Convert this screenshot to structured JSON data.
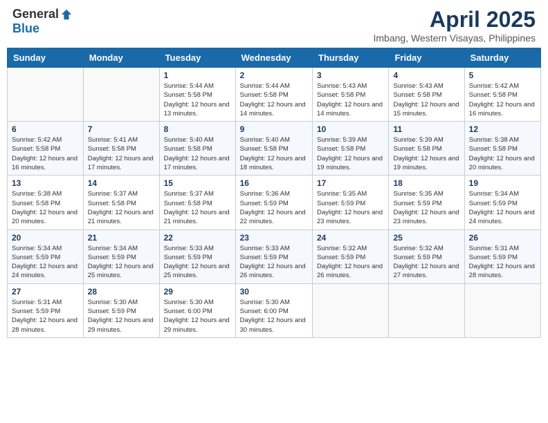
{
  "header": {
    "logo_general": "General",
    "logo_blue": "Blue",
    "month_title": "April 2025",
    "location": "Imbang, Western Visayas, Philippines"
  },
  "weekdays": [
    "Sunday",
    "Monday",
    "Tuesday",
    "Wednesday",
    "Thursday",
    "Friday",
    "Saturday"
  ],
  "weeks": [
    [
      {
        "day": "",
        "info": ""
      },
      {
        "day": "",
        "info": ""
      },
      {
        "day": "1",
        "info": "Sunrise: 5:44 AM\nSunset: 5:58 PM\nDaylight: 12 hours\nand 13 minutes."
      },
      {
        "day": "2",
        "info": "Sunrise: 5:44 AM\nSunset: 5:58 PM\nDaylight: 12 hours\nand 14 minutes."
      },
      {
        "day": "3",
        "info": "Sunrise: 5:43 AM\nSunset: 5:58 PM\nDaylight: 12 hours\nand 14 minutes."
      },
      {
        "day": "4",
        "info": "Sunrise: 5:43 AM\nSunset: 5:58 PM\nDaylight: 12 hours\nand 15 minutes."
      },
      {
        "day": "5",
        "info": "Sunrise: 5:42 AM\nSunset: 5:58 PM\nDaylight: 12 hours\nand 16 minutes."
      }
    ],
    [
      {
        "day": "6",
        "info": "Sunrise: 5:42 AM\nSunset: 5:58 PM\nDaylight: 12 hours\nand 16 minutes."
      },
      {
        "day": "7",
        "info": "Sunrise: 5:41 AM\nSunset: 5:58 PM\nDaylight: 12 hours\nand 17 minutes."
      },
      {
        "day": "8",
        "info": "Sunrise: 5:40 AM\nSunset: 5:58 PM\nDaylight: 12 hours\nand 17 minutes."
      },
      {
        "day": "9",
        "info": "Sunrise: 5:40 AM\nSunset: 5:58 PM\nDaylight: 12 hours\nand 18 minutes."
      },
      {
        "day": "10",
        "info": "Sunrise: 5:39 AM\nSunset: 5:58 PM\nDaylight: 12 hours\nand 19 minutes."
      },
      {
        "day": "11",
        "info": "Sunrise: 5:39 AM\nSunset: 5:58 PM\nDaylight: 12 hours\nand 19 minutes."
      },
      {
        "day": "12",
        "info": "Sunrise: 5:38 AM\nSunset: 5:58 PM\nDaylight: 12 hours\nand 20 minutes."
      }
    ],
    [
      {
        "day": "13",
        "info": "Sunrise: 5:38 AM\nSunset: 5:58 PM\nDaylight: 12 hours\nand 20 minutes."
      },
      {
        "day": "14",
        "info": "Sunrise: 5:37 AM\nSunset: 5:58 PM\nDaylight: 12 hours\nand 21 minutes."
      },
      {
        "day": "15",
        "info": "Sunrise: 5:37 AM\nSunset: 5:58 PM\nDaylight: 12 hours\nand 21 minutes."
      },
      {
        "day": "16",
        "info": "Sunrise: 5:36 AM\nSunset: 5:59 PM\nDaylight: 12 hours\nand 22 minutes."
      },
      {
        "day": "17",
        "info": "Sunrise: 5:35 AM\nSunset: 5:59 PM\nDaylight: 12 hours\nand 23 minutes."
      },
      {
        "day": "18",
        "info": "Sunrise: 5:35 AM\nSunset: 5:59 PM\nDaylight: 12 hours\nand 23 minutes."
      },
      {
        "day": "19",
        "info": "Sunrise: 5:34 AM\nSunset: 5:59 PM\nDaylight: 12 hours\nand 24 minutes."
      }
    ],
    [
      {
        "day": "20",
        "info": "Sunrise: 5:34 AM\nSunset: 5:59 PM\nDaylight: 12 hours\nand 24 minutes."
      },
      {
        "day": "21",
        "info": "Sunrise: 5:34 AM\nSunset: 5:59 PM\nDaylight: 12 hours\nand 25 minutes."
      },
      {
        "day": "22",
        "info": "Sunrise: 5:33 AM\nSunset: 5:59 PM\nDaylight: 12 hours\nand 25 minutes."
      },
      {
        "day": "23",
        "info": "Sunrise: 5:33 AM\nSunset: 5:59 PM\nDaylight: 12 hours\nand 26 minutes."
      },
      {
        "day": "24",
        "info": "Sunrise: 5:32 AM\nSunset: 5:59 PM\nDaylight: 12 hours\nand 26 minutes."
      },
      {
        "day": "25",
        "info": "Sunrise: 5:32 AM\nSunset: 5:59 PM\nDaylight: 12 hours\nand 27 minutes."
      },
      {
        "day": "26",
        "info": "Sunrise: 5:31 AM\nSunset: 5:59 PM\nDaylight: 12 hours\nand 28 minutes."
      }
    ],
    [
      {
        "day": "27",
        "info": "Sunrise: 5:31 AM\nSunset: 5:59 PM\nDaylight: 12 hours\nand 28 minutes."
      },
      {
        "day": "28",
        "info": "Sunrise: 5:30 AM\nSunset: 5:59 PM\nDaylight: 12 hours\nand 29 minutes."
      },
      {
        "day": "29",
        "info": "Sunrise: 5:30 AM\nSunset: 6:00 PM\nDaylight: 12 hours\nand 29 minutes."
      },
      {
        "day": "30",
        "info": "Sunrise: 5:30 AM\nSunset: 6:00 PM\nDaylight: 12 hours\nand 30 minutes."
      },
      {
        "day": "",
        "info": ""
      },
      {
        "day": "",
        "info": ""
      },
      {
        "day": "",
        "info": ""
      }
    ]
  ]
}
